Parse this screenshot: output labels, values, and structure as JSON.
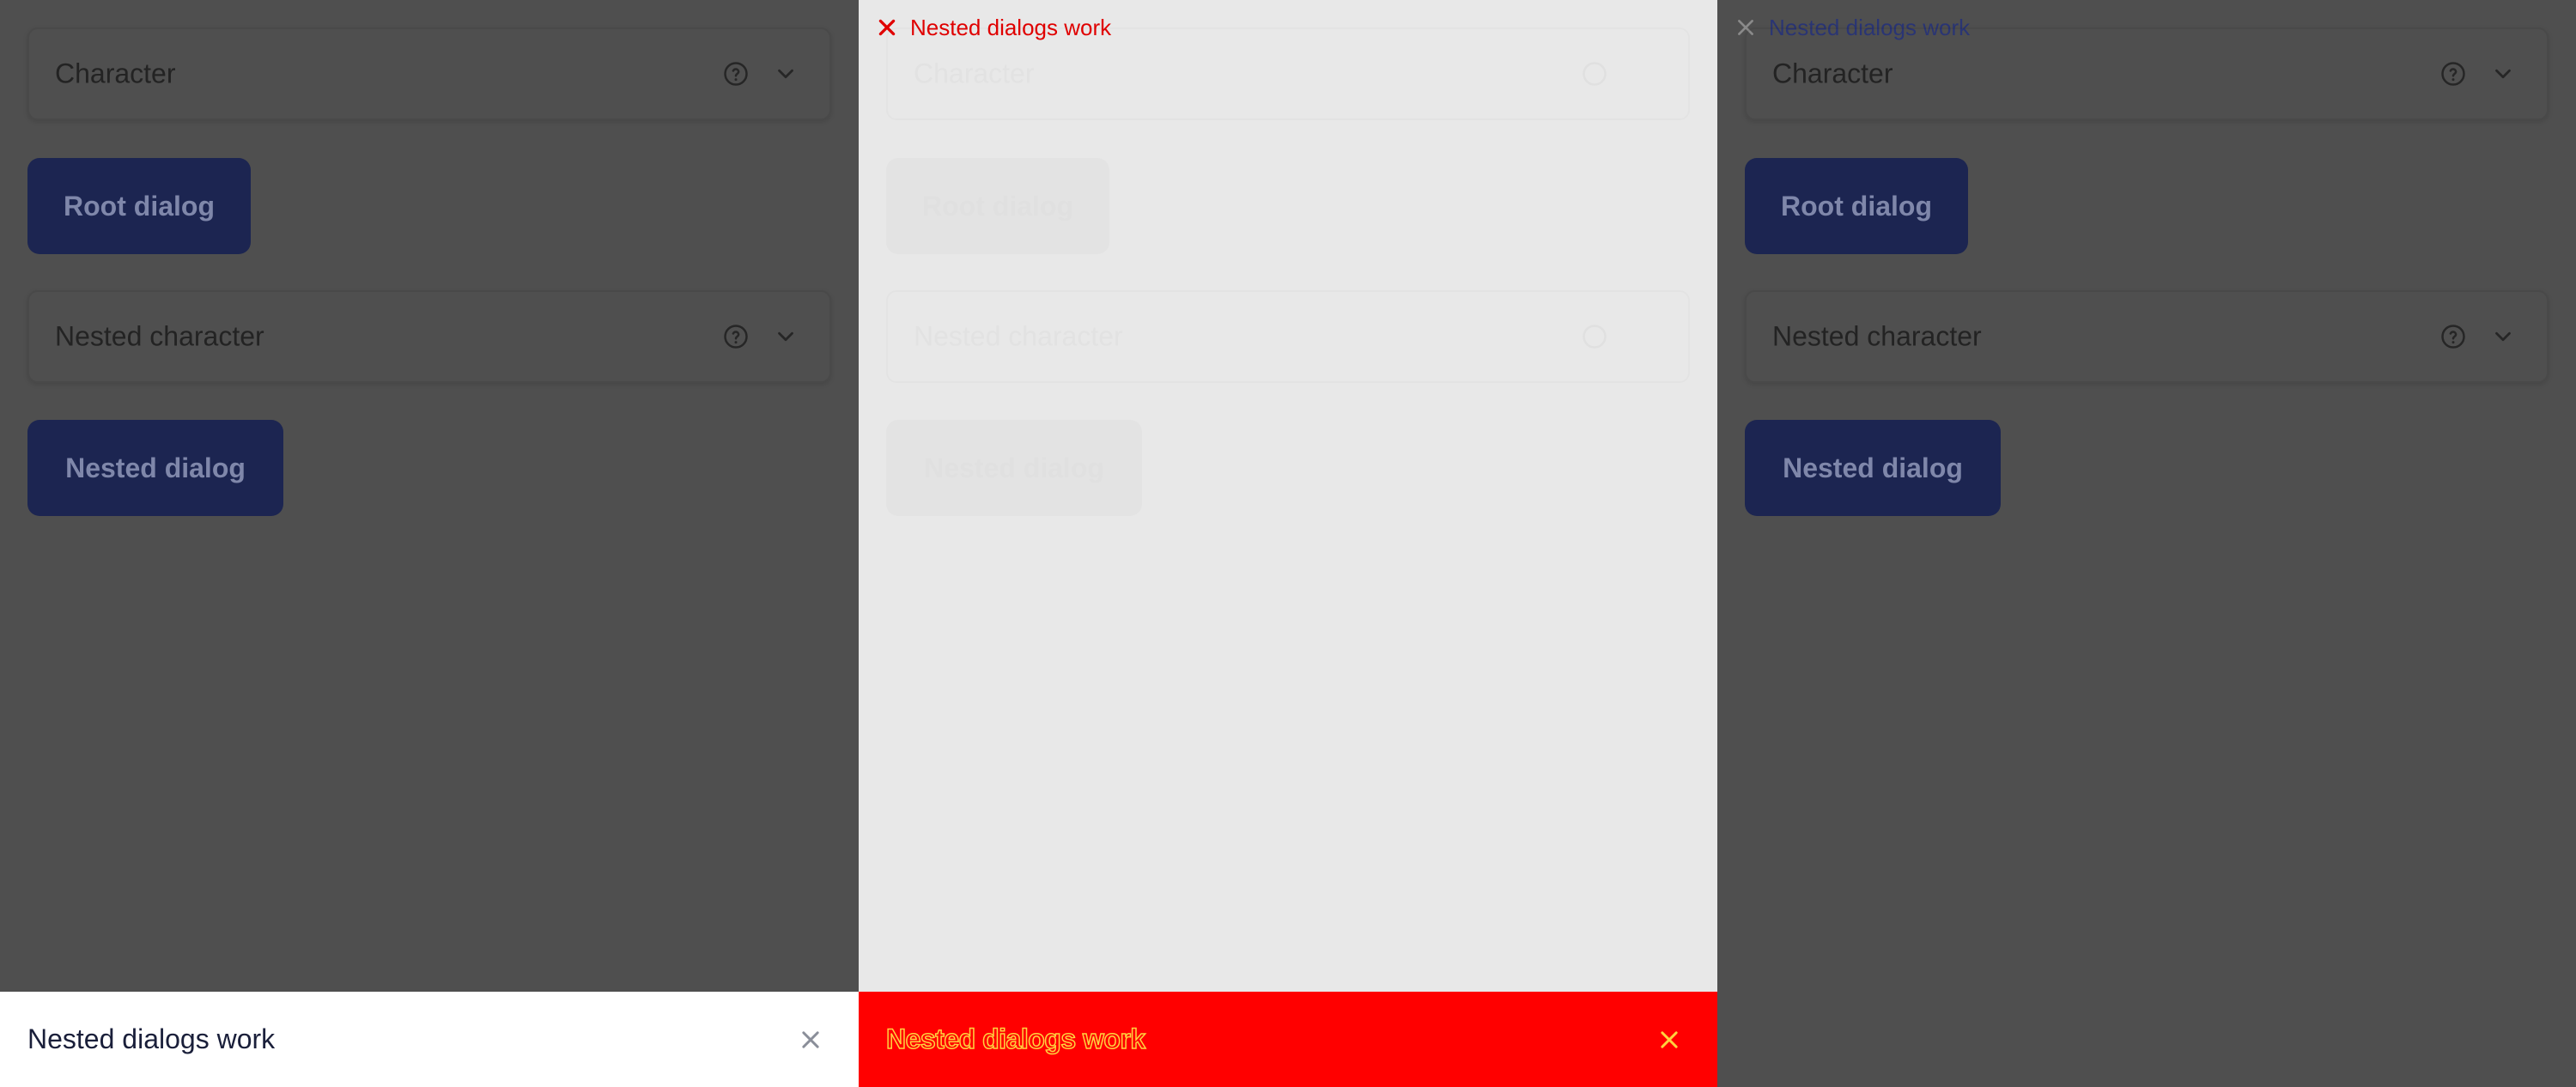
{
  "colors": {
    "overlay": "#4f4f4f",
    "button_bg": "#1c2551",
    "toast_red": "#ff0000",
    "text_red": "#e00000",
    "outline_yellow": "#ffd23f"
  },
  "panels": {
    "left": {
      "character_label": "Character",
      "root_button": "Root dialog",
      "nested_character_label": "Nested character",
      "nested_button": "Nested dialog"
    },
    "middle": {
      "header_title": "Nested dialogs work",
      "character_label": "Character",
      "root_button": "Root dialog",
      "nested_character_label": "Nested character",
      "nested_button": "Nested dialog"
    },
    "right": {
      "header_title": "Nested dialogs work",
      "character_label": "Character",
      "root_button": "Root dialog",
      "nested_character_label": "Nested character",
      "nested_button": "Nested dialog"
    }
  },
  "toasts": {
    "left": {
      "text": "Nested dialogs work",
      "close_icon": "close-icon"
    },
    "middle": {
      "text": "Nested dialogs work",
      "close_icon": "close-icon"
    }
  },
  "icons": {
    "help": "help-circle-icon",
    "chevron": "chevron-down-icon",
    "close": "close-icon"
  }
}
